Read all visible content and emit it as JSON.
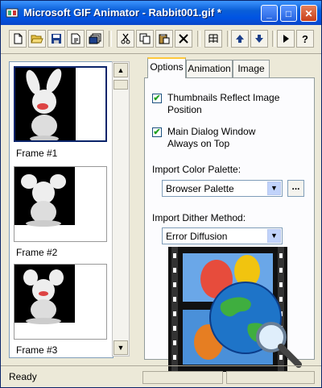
{
  "window": {
    "title": "Microsoft GIF Animator - Rabbit001.gif *"
  },
  "titlebar_buttons": {
    "minimize": "_",
    "maximize": "□",
    "close": "✕"
  },
  "toolbar": {
    "help": "?"
  },
  "frames": [
    {
      "label": "Frame #1"
    },
    {
      "label": "Frame #2"
    },
    {
      "label": "Frame #3"
    }
  ],
  "tabs": [
    {
      "label": "Options"
    },
    {
      "label": "Animation"
    },
    {
      "label": "Image"
    }
  ],
  "options": {
    "thumbnails_reflect": {
      "label_line1": "Thumbnails Reflect Image",
      "label_line2": "Position",
      "checked": true
    },
    "main_on_top": {
      "label_line1": "Main Dialog Window",
      "label_line2": "Always on Top",
      "checked": true
    },
    "import_palette": {
      "label": "Import Color Palette:",
      "value": "Browser Palette",
      "browse": "..."
    },
    "import_dither": {
      "label": "Import Dither Method:",
      "value": "Error Diffusion"
    }
  },
  "status": {
    "text": "Ready"
  },
  "colors": {
    "title_bar": "#0054e3",
    "face": "#ece9d8",
    "globe": "#1e74c8"
  }
}
